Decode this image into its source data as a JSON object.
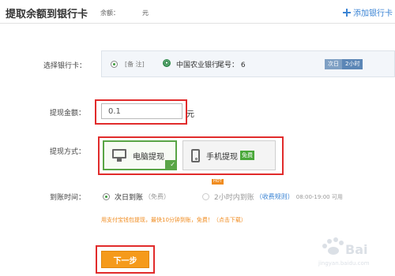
{
  "header": {
    "title": "提取余额到银行卡",
    "balance_label": "余额：",
    "balance_value": "",
    "balance_unit": "元",
    "add_card_label": "添加银行卡"
  },
  "bank": {
    "label": "选择银行卡：",
    "note": "[备 注]",
    "bank_name": "中国农业银行",
    "card_number": "尾号：  6",
    "arrival_next_day": "次日",
    "arrival_two_hours": "2小时"
  },
  "amount": {
    "label": "提现金额：",
    "value": "0.1",
    "unit": "元"
  },
  "method": {
    "label": "提现方式：",
    "options": [
      {
        "label": "电脑提现",
        "selected": true
      },
      {
        "label": "手机提现",
        "badge": "免费",
        "selected": false
      }
    ]
  },
  "arrival": {
    "label": "到账时间：",
    "hot_badge": "HOT",
    "option_next_day": "次日到账",
    "option_next_day_note": "（免费）",
    "option_two_hours": "2小时内到账",
    "option_two_hours_link": "（收费规则）",
    "option_two_hours_time": "08:00-19:00 可用",
    "notice": "用支付宝钱包提现，最快10分钟到账，免费！（点击下载）"
  },
  "next_button_label": "下一步",
  "colors": {
    "accent_blue": "#3b84d4",
    "highlight_red": "#e12b2b",
    "selected_green": "#59a546",
    "button_orange": "#f59a1b"
  }
}
